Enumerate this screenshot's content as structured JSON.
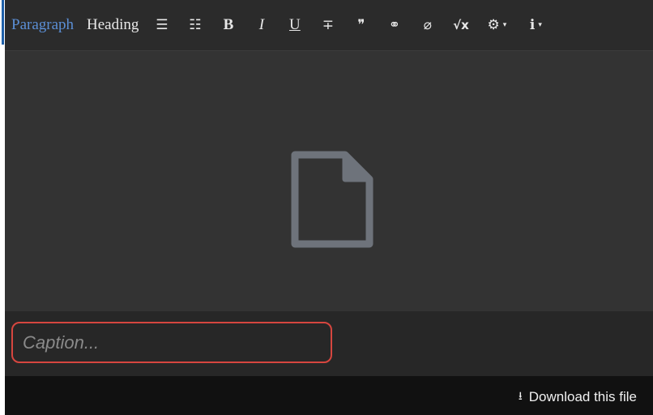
{
  "toolbar": {
    "paragraph_label": "Paragraph",
    "heading_label": "Heading",
    "bullet_list_glyph": "☰",
    "numbered_list_glyph": "☷",
    "bold_label": "B",
    "italic_label": "I",
    "underline_label": "U",
    "strikethrough_glyph": "∓",
    "quote_glyph": "❞",
    "link_glyph": "⚭",
    "attach_glyph": "⌀",
    "math_label": "√x",
    "style_glyph": "⚙",
    "info_glyph": "ℹ",
    "caret_glyph": "▾"
  },
  "caption": {
    "placeholder": "Caption..."
  },
  "footer": {
    "download_label": "Download this file",
    "download_glyph": "⭳"
  },
  "colors": {
    "active_text": "#5b8fd6",
    "caption_border": "#d6463f",
    "file_icon": "#6e737b"
  }
}
